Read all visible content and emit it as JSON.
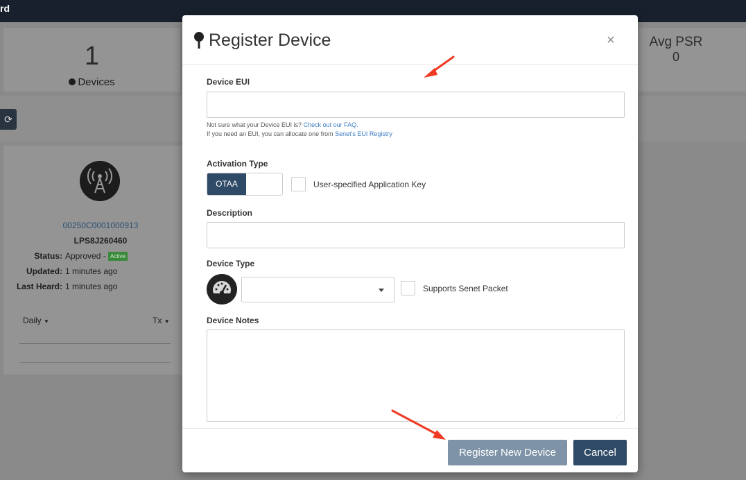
{
  "background": {
    "topbar_title": "rd",
    "stats": {
      "devices_count": "1",
      "devices_label": "Devices",
      "avg_psr_label": "Avg PSR",
      "avg_psr_value": "0"
    },
    "refresh_icon": "refresh-icon",
    "device_card": {
      "device_id": "00250C0001000913",
      "model": "LPS8J260460",
      "status_label": "Status:",
      "status_value": "Approved -",
      "status_badge": "Active",
      "updated_label": "Updated:",
      "updated_value": "1 minutes ago",
      "last_heard_label": "Last Heard:",
      "last_heard_value": "1 minutes ago",
      "period_dropdown": "Daily",
      "metric_dropdown": "Tx"
    }
  },
  "modal": {
    "title": "Register Device",
    "close_label": "×",
    "device_eui": {
      "label": "Device EUI",
      "value": "",
      "help_line1_prefix": "Not sure what your Device EUI is?",
      "help_line1_link": "Check out our FAQ.",
      "help_line2_prefix": "If you need an EUI, you can allocate one from",
      "help_line2_link": "Senet's EUI Registry"
    },
    "activation_type": {
      "label": "Activation Type",
      "selected": "OTAA",
      "checkbox_label": "User-specified Application Key"
    },
    "description": {
      "label": "Description",
      "value": ""
    },
    "device_type": {
      "label": "Device Type",
      "selected": "",
      "checkbox_label": "Supports Senet Packet"
    },
    "device_notes": {
      "label": "Device Notes",
      "value": ""
    },
    "buttons": {
      "register": "Register New Device",
      "cancel": "Cancel"
    }
  },
  "colors": {
    "primary": "#2f4a66",
    "primary_light": "#7e93a7",
    "link": "#3a7cc3",
    "annotation_arrow": "#f03a24"
  }
}
